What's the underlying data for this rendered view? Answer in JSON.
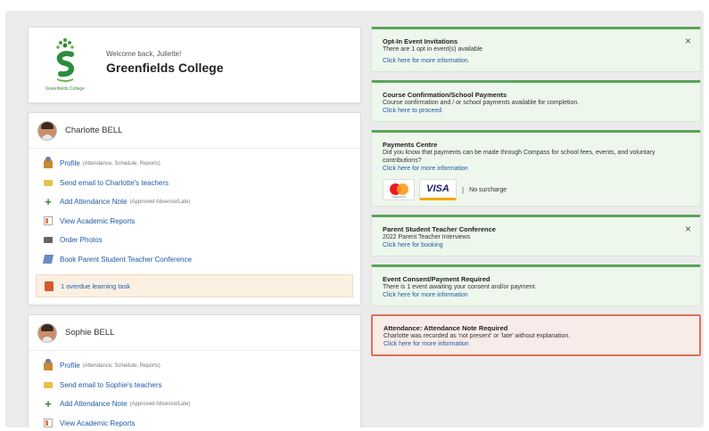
{
  "welcome": {
    "greeting": "Welcome back, Juliette!",
    "school_name": "Greenfields College",
    "logo_caption": "Greenfields College"
  },
  "students": [
    {
      "name": "Charlotte BELL",
      "links": [
        {
          "icon": "user-icon",
          "label": "Profile",
          "sub": "(Attendance, Schedule, Reports)"
        },
        {
          "icon": "mail-icon",
          "label": "Send email to Charlotte's teachers",
          "sub": ""
        },
        {
          "icon": "plus-icon",
          "label": "Add Attendance Note",
          "sub": "(Approved Absence/Late)"
        },
        {
          "icon": "report-icon",
          "label": "View Academic Reports",
          "sub": ""
        },
        {
          "icon": "photo-icon",
          "label": "Order Photos",
          "sub": ""
        },
        {
          "icon": "book-icon",
          "label": "Book Parent Student Teacher Conference",
          "sub": ""
        }
      ],
      "task": "1 overdue learning task"
    },
    {
      "name": "Sophie BELL",
      "links": [
        {
          "icon": "user-icon",
          "label": "Profile",
          "sub": "(Attendance, Schedule, Reports)"
        },
        {
          "icon": "mail-icon",
          "label": "Send email to Sophie's teachers",
          "sub": ""
        },
        {
          "icon": "plus-icon",
          "label": "Add Attendance Note",
          "sub": "(Approved Absence/Late)"
        },
        {
          "icon": "report-icon",
          "label": "View Academic Reports",
          "sub": ""
        }
      ]
    }
  ],
  "notices": [
    {
      "title": "Opt-In Event Invitations",
      "body": "There are 1 opt in event(s) available",
      "link": "Click here for more information."
    },
    {
      "title": "Course Confirmation/School Payments",
      "body": "Course confirmation and / or school payments available for completion.",
      "link": "Click here to proceed"
    },
    {
      "title": "Payments Centre",
      "body": "Did you know that payments can be made through Compass for school fees, events, and voluntary contributions?",
      "link": "Click here for more information",
      "payment": {
        "visa": "VISA",
        "mastercard_caption": "mastercard",
        "separator": "|",
        "surcharge": "No surcharge"
      }
    },
    {
      "title": "Parent Student Teacher Conference",
      "body": "2022 Parent Teacher Interviews",
      "link": "Click here for booking"
    },
    {
      "title": "Event Consent/Payment Required",
      "body": "There is 1 event awaiting your consent and/or payment.",
      "link": "Click here for more information"
    },
    {
      "title": "Attendance: Attendance Note Required",
      "body": "Charlotte was recorded as 'not present' or 'late' without explanation.",
      "link": "Click here for more information"
    }
  ],
  "close_glyph": "×",
  "colors": {
    "background": "#ebebeb",
    "link": "#1f5aa8",
    "notice_accent": "#5aa65a",
    "notice_bg": "#eef7ec",
    "alert_border": "#e0705a",
    "alert_bg": "#f8ece8",
    "task_bg": "#fcf0e2"
  }
}
